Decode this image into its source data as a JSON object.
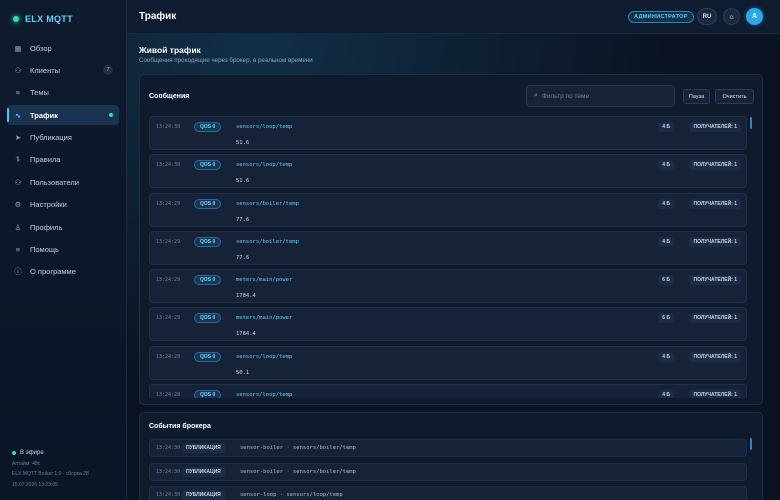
{
  "sidebar": {
    "brand": "ELX MQTT",
    "items": [
      {
        "label": "Обзор",
        "icon": "overview-icon",
        "glyph": "▦"
      },
      {
        "label": "Клиенты",
        "icon": "clients-icon",
        "glyph": "⚇",
        "badge": "7"
      },
      {
        "label": "Темы",
        "icon": "topics-icon",
        "glyph": "≡"
      },
      {
        "label": "Трафик",
        "icon": "traffic-icon",
        "glyph": "∿",
        "active": true
      },
      {
        "label": "Публикация",
        "icon": "send-icon",
        "glyph": "➤"
      },
      {
        "label": "Правила",
        "icon": "rules-icon",
        "glyph": "⥮"
      },
      {
        "label": "Пользователи",
        "icon": "users-icon",
        "glyph": "⚇"
      },
      {
        "label": "Настройки",
        "icon": "gear-icon",
        "glyph": "⚙"
      },
      {
        "label": "Профиль",
        "icon": "profile-icon",
        "glyph": "♙"
      },
      {
        "label": "Помощь",
        "icon": "help-icon",
        "glyph": "≡"
      },
      {
        "label": "О программе",
        "icon": "info-icon",
        "glyph": "ⓘ"
      }
    ],
    "footer": {
      "status": "В эфире",
      "uptime": "Аптайм: 48с",
      "version": "ELX MQTT Broker 1.0 · сборка 28",
      "datetime": "15.07.2026 13:23:05"
    }
  },
  "header": {
    "title": "Трафик",
    "role_badge": "АДМИНИСТРАТОР",
    "lang": "RU",
    "avatar_initial": "A"
  },
  "section": {
    "title": "Живой трафик",
    "subtitle": "Сообщения проходящие через брокер, в реальном времени"
  },
  "messages": {
    "title": "Сообщения",
    "filter_placeholder": "Фильтр по теме",
    "pause_label": "Пауза",
    "clear_label": "Очистить",
    "rows": [
      {
        "time": "13:24:30",
        "qos": "QOS 0",
        "topic": "sensors/loop/temp",
        "payload": "51.6",
        "size": "4 Б",
        "receivers": "ПОЛУЧАТЕЛЕЙ: 1"
      },
      {
        "time": "13:24:30",
        "qos": "QOS 0",
        "topic": "sensors/loop/temp",
        "payload": "51.6",
        "size": "4 Б",
        "receivers": "ПОЛУЧАТЕЛЕЙ: 1"
      },
      {
        "time": "13:24:29",
        "qos": "QOS 0",
        "topic": "sensors/boiler/temp",
        "payload": "77.6",
        "size": "4 Б",
        "receivers": "ПОЛУЧАТЕЛЕЙ: 1"
      },
      {
        "time": "13:24:29",
        "qos": "QOS 0",
        "topic": "sensors/boiler/temp",
        "payload": "77.6",
        "size": "4 Б",
        "receivers": "ПОЛУЧАТЕЛЕЙ: 1"
      },
      {
        "time": "13:24:29",
        "qos": "QOS 0",
        "topic": "meters/main/power",
        "payload": "1784.4",
        "size": "6 Б",
        "receivers": "ПОЛУЧАТЕЛЕЙ: 1"
      },
      {
        "time": "13:24:29",
        "qos": "QOS 0",
        "topic": "meters/main/power",
        "payload": "1784.4",
        "size": "6 Б",
        "receivers": "ПОЛУЧАТЕЛЕЙ: 1"
      },
      {
        "time": "13:24:28",
        "qos": "QOS 0",
        "topic": "sensors/loop/temp",
        "payload": "50.1",
        "size": "4 Б",
        "receivers": "ПОЛУЧАТЕЛЕЙ: 1"
      },
      {
        "time": "13:24:28",
        "qos": "QOS 0",
        "topic": "sensors/loop/temp",
        "payload": "",
        "size": "4 Б",
        "receivers": "ПОЛУЧАТЕЛЕЙ: 1"
      }
    ]
  },
  "events": {
    "title": "События брокера",
    "rows": [
      {
        "time": "13:24:30",
        "kind": "ПУБЛИКАЦИЯ",
        "detail": "sensor-boiler · sensors/boiler/temp"
      },
      {
        "time": "13:24:30",
        "kind": "ПУБЛИКАЦИЯ",
        "detail": "sensor-boiler · sensors/boiler/temp"
      },
      {
        "time": "13:24:30",
        "kind": "ПУБЛИКАЦИЯ",
        "detail": "sensor-loop · sensors/loop/temp"
      }
    ]
  },
  "colors": {
    "accent": "#48c7f5",
    "live": "#2de3a6",
    "background": "#0b1322"
  }
}
